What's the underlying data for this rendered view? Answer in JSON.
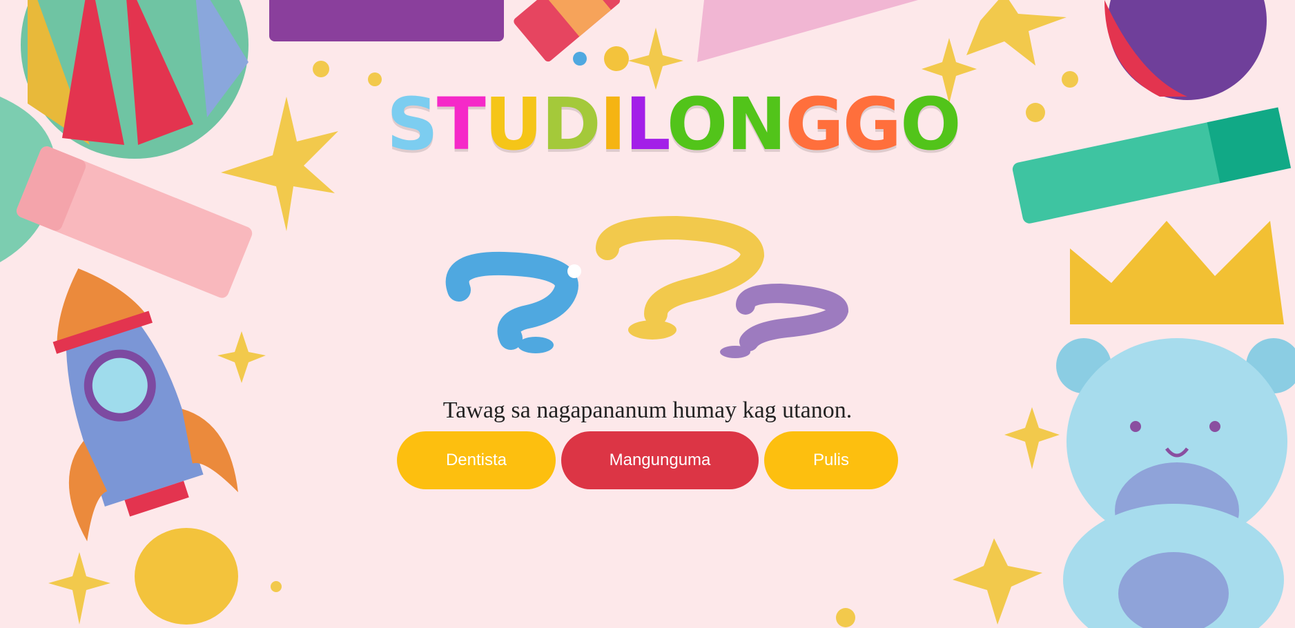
{
  "logo": {
    "letters": [
      "S",
      "T",
      "U",
      "D",
      "I",
      "L",
      "O",
      "N",
      "G",
      "G",
      "O"
    ],
    "colors": [
      "#7ccdf0",
      "#f529c8",
      "#f5c518",
      "#a4c93a",
      "#f5b413",
      "#a31fe8",
      "#52c41a",
      "#52c41a",
      "#ff6f3c",
      "#ff6f3c",
      "#52c41a"
    ]
  },
  "question": {
    "text": "Tawag sa nagapananum humay kag utanon."
  },
  "answers": [
    {
      "label": "Dentista",
      "color": "#fdbf0f"
    },
    {
      "label": "Mangunguma",
      "color": "#dc3545"
    },
    {
      "label": "Pulis",
      "color": "#fdbf0f"
    }
  ],
  "icons": [
    "beach-ball-icon",
    "rocket-icon",
    "teddy-bear-icon",
    "crown-icon",
    "star-icon",
    "question-marks-icon",
    "crayon-icon"
  ]
}
